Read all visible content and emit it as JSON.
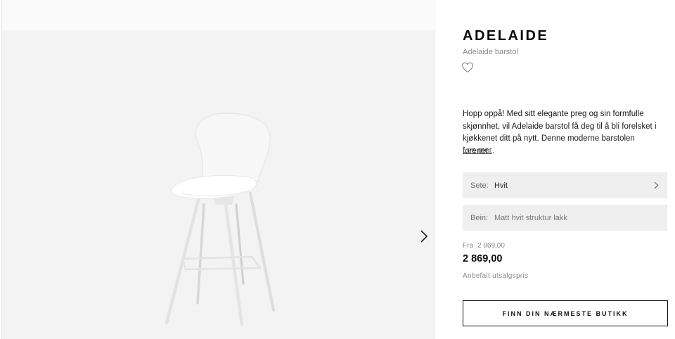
{
  "product": {
    "name": "ADELAIDE",
    "subtitle": "Adelaide barstol",
    "description": "Hopp oppå! Med sitt elegante preg og sin formfulle skjønnhet, vil Adelaide barstol få deg til å bli forelsket i kjøkkenet ditt på nytt. Denne moderne barstolen forener...",
    "read_more": "Les mer"
  },
  "options": [
    {
      "label": "Sete:",
      "value": "Hvit"
    },
    {
      "label": "Bein:",
      "value": "Matt hvit struktur lakk"
    }
  ],
  "pricing": {
    "from_label": "Fra",
    "from_price": "2 869,00",
    "price": "2 869,00",
    "rrp_label": "Anbefalt utsalgspris"
  },
  "cta": {
    "find_store": "FINN DIN NÆRMESTE BUTIKK"
  },
  "icons": {
    "favorite": "heart-icon",
    "next": "chevron-right-icon",
    "option_arrow": "chevron-right-icon"
  },
  "colors": {
    "gallery_bg": "#f3f3f3",
    "option_bg": "#efefef",
    "text": "#111111"
  }
}
